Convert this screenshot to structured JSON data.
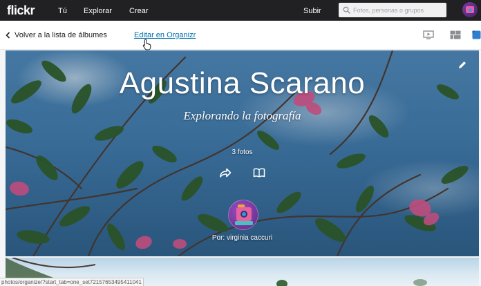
{
  "topbar": {
    "logo": "flickr",
    "nav": [
      "Tú",
      "Explorar",
      "Crear"
    ],
    "upload": "Subir",
    "search_placeholder": "Fotos, personas o grupos"
  },
  "subbar": {
    "back": "Volver a la lista de álbumes",
    "edit": "Editar en Organizr",
    "icons": [
      "slideshow-icon",
      "grid-icon",
      "info-icon"
    ]
  },
  "album": {
    "title": "Agustina Scarano",
    "subtitle": "Explorando la fotografía",
    "count": "3 fotos",
    "owner": "Por: virginia caccuri"
  },
  "status_url": "photos/organize/?start_tab=one_set72157653495411041",
  "colors": {
    "topbar_bg": "#212124",
    "link": "#006dac",
    "flickr_pink": "#ff0084",
    "flickr_blue": "#0063dc"
  }
}
